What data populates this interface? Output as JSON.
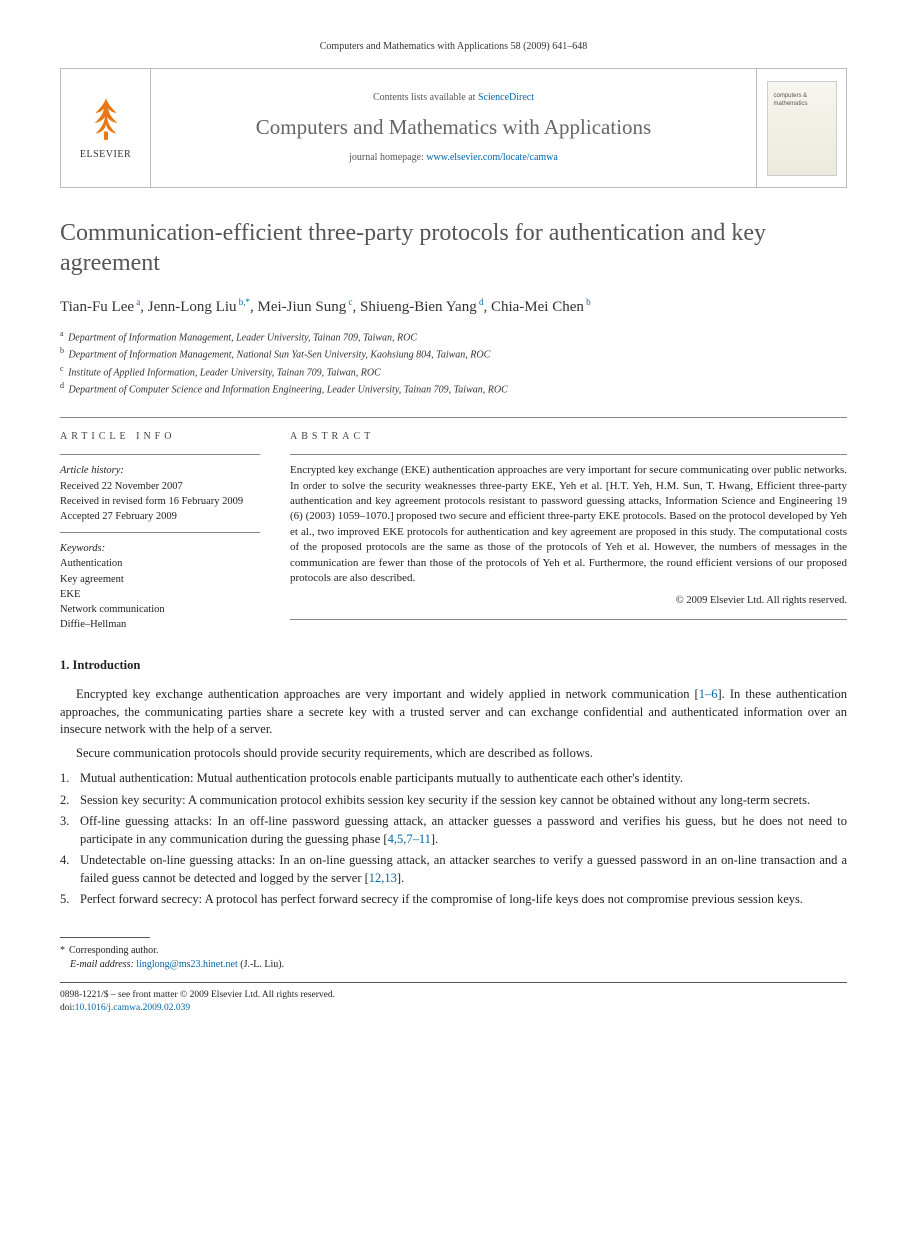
{
  "running_head": "Computers and Mathematics with Applications 58 (2009) 641–648",
  "masthead": {
    "publisher": "ELSEVIER",
    "contents_prefix": "Contents lists available at ",
    "contents_link": "ScienceDirect",
    "journal_name": "Computers and Mathematics with Applications",
    "homepage_prefix": "journal homepage: ",
    "homepage_link": "www.elsevier.com/locate/camwa"
  },
  "title": "Communication-efficient three-party protocols for authentication and key agreement",
  "authors_html": "Tian-Fu Lee|a|, Jenn-Long Liu|b,*|, Mei-Jiun Sung|c|, Shiueng-Bien Yang|d|, Chia-Mei Chen|b",
  "authors": [
    {
      "name": "Tian-Fu Lee",
      "sup": "a"
    },
    {
      "name": "Jenn-Long Liu",
      "sup": "b,*"
    },
    {
      "name": "Mei-Jiun Sung",
      "sup": "c"
    },
    {
      "name": "Shiueng-Bien Yang",
      "sup": "d"
    },
    {
      "name": "Chia-Mei Chen",
      "sup": "b"
    }
  ],
  "affiliations": [
    {
      "sup": "a",
      "text": "Department of Information Management, Leader University, Tainan 709, Taiwan, ROC"
    },
    {
      "sup": "b",
      "text": "Department of Information Management, National Sun Yat-Sen University, Kaohsiung 804, Taiwan, ROC"
    },
    {
      "sup": "c",
      "text": "Institute of Applied Information, Leader University, Tainan 709, Taiwan, ROC"
    },
    {
      "sup": "d",
      "text": "Department of Computer Science and Information Engineering, Leader University, Tainan 709, Taiwan, ROC"
    }
  ],
  "article_info": {
    "head": "ARTICLE INFO",
    "history_label": "Article history:",
    "history": [
      "Received 22 November 2007",
      "Received in revised form 16 February 2009",
      "Accepted 27 February 2009"
    ],
    "keywords_label": "Keywords:",
    "keywords": [
      "Authentication",
      "Key agreement",
      "EKE",
      "Network communication",
      "Diffie–Hellman"
    ]
  },
  "abstract": {
    "head": "ABSTRACT",
    "text": "Encrypted key exchange (EKE) authentication approaches are very important for secure communicating over public networks. In order to solve the security weaknesses three-party EKE, Yeh et al. [H.T. Yeh, H.M. Sun, T. Hwang, Efficient three-party authentication and key agreement protocols resistant to password guessing attacks, Information Science and Engineering 19 (6) (2003) 1059–1070.] proposed two secure and efficient three-party EKE protocols. Based on the protocol developed by Yeh et al., two improved EKE protocols for authentication and key agreement are proposed in this study. The computational costs of the proposed protocols are the same as those of the protocols of Yeh et al. However, the numbers of messages in the communication are fewer than those of the protocols of Yeh et al. Furthermore, the round efficient versions of our proposed protocols are also described.",
    "copyright": "© 2009 Elsevier Ltd. All rights reserved."
  },
  "section1": {
    "head": "1. Introduction",
    "para1_pre": "Encrypted key exchange authentication approaches are very important and widely applied in network communication [",
    "para1_cite": "1–6",
    "para1_post": "]. In these authentication approaches, the communicating parties share a secrete key with a trusted server and can exchange confidential and authenticated information over an insecure network with the help of a server.",
    "para2": "Secure communication protocols should provide security requirements, which are described as follows.",
    "requirements": [
      {
        "num": "1.",
        "text": "Mutual authentication: Mutual authentication protocols enable participants mutually to authenticate each other's identity."
      },
      {
        "num": "2.",
        "text": "Session key security: A communication protocol exhibits session key security if the session key cannot be obtained without any long-term secrets."
      },
      {
        "num": "3.",
        "text_pre": "Off-line guessing attacks: In an off-line password guessing attack, an attacker guesses a password and verifies his guess, but he does not need to participate in any communication during the guessing phase [",
        "cite": "4,5,7–11",
        "text_post": "]."
      },
      {
        "num": "4.",
        "text_pre": "Undetectable on-line guessing attacks: In an on-line guessing attack, an attacker searches to verify a guessed password in an on-line transaction and a failed guess cannot be detected and logged by the server [",
        "cite": "12,13",
        "text_post": "]."
      },
      {
        "num": "5.",
        "text": "Perfect forward secrecy: A protocol has perfect forward secrecy if the compromise of long-life keys does not compromise previous session keys."
      }
    ]
  },
  "footnote": {
    "corresponding": "Corresponding author.",
    "email_label": "E-mail address:",
    "email": "linglong@ms23.hinet.net",
    "email_who": "(J.-L. Liu)."
  },
  "bottom": {
    "issn_line": "0898-1221/$ – see front matter © 2009 Elsevier Ltd. All rights reserved.",
    "doi_prefix": "doi:",
    "doi": "10.1016/j.camwa.2009.02.039"
  }
}
